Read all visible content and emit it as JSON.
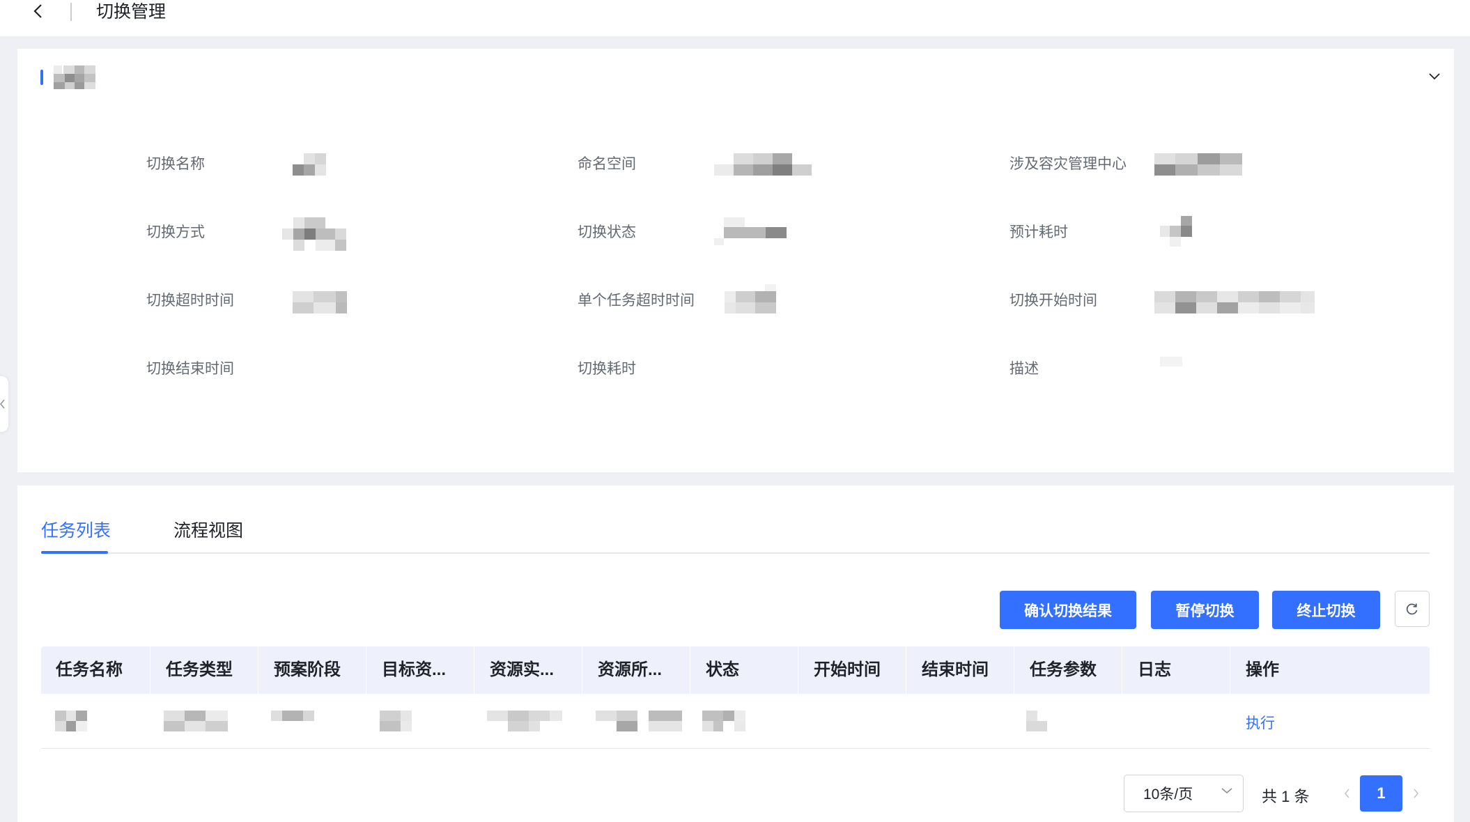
{
  "header": {
    "title": "切换管理",
    "back_icon": "chevron-left-icon"
  },
  "info_card": {
    "collapse_icon": "chevron-down-icon",
    "fields": {
      "switch_name_label": "切换名称",
      "namespace_label": "命名空间",
      "dr_center_label": "涉及容灾管理中心",
      "switch_mode_label": "切换方式",
      "switch_status_label": "切换状态",
      "estimated_duration_label": "预计耗时",
      "switch_timeout_label": "切换超时时间",
      "single_task_timeout_label": "单个任务超时时间",
      "switch_start_time_label": "切换开始时间",
      "switch_end_time_label": "切换结束时间",
      "switch_duration_label": "切换耗时",
      "description_label": "描述"
    }
  },
  "tasks": {
    "tabs": [
      {
        "label": "任务列表",
        "active": true
      },
      {
        "label": "流程视图",
        "active": false
      }
    ],
    "actions": {
      "confirm_label": "确认切换结果",
      "pause_label": "暂停切换",
      "terminate_label": "终止切换",
      "refresh_icon": "refresh-icon"
    },
    "table": {
      "columns": [
        "任务名称",
        "任务类型",
        "预案阶段",
        "目标资...",
        "资源实...",
        "资源所...",
        "状态",
        "开始时间",
        "结束时间",
        "任务参数",
        "日志",
        "操作"
      ],
      "rows": [
        {
          "action_label": "执行"
        }
      ]
    },
    "pagination": {
      "page_size_label": "10条/页",
      "total_label": "共 1 条",
      "current_page": "1"
    }
  },
  "colors": {
    "accent": "#3370ff",
    "background": "#eef0f4",
    "table_header": "#eef1fb"
  }
}
